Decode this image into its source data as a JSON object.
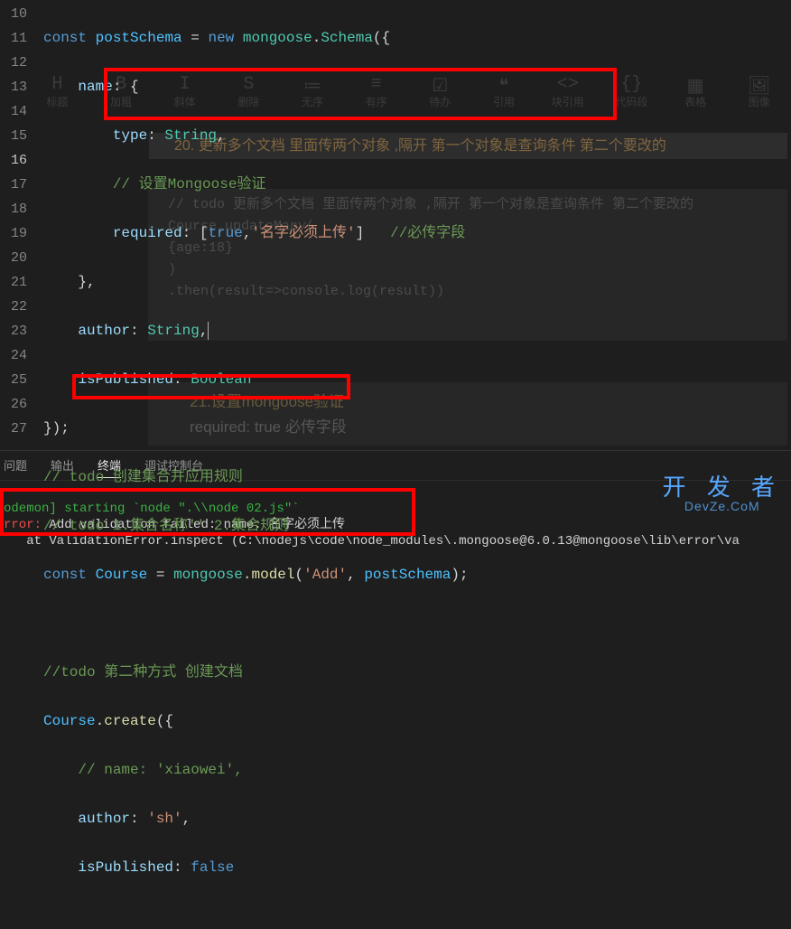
{
  "gutter": [
    "10",
    "11",
    "12",
    "13",
    "14",
    "15",
    "16",
    "17",
    "18",
    "19",
    "20",
    "21",
    "22",
    "23",
    "24",
    "25",
    "26",
    "27"
  ],
  "current_line": "16",
  "code": {
    "l10": {
      "kw": "const",
      "var": "postSchema",
      "op": "=",
      "kw2": "new",
      "cls": "mongoose",
      "punct1": ".",
      "cls2": "Schema",
      "punct2": "({"
    },
    "l11": {
      "prop": "name",
      "punct": ": {"
    },
    "l12": {
      "prop": "type",
      "punct": ": ",
      "cls": "String",
      "comma": ","
    },
    "l13": {
      "cmt": "// 设置Mongoose验证"
    },
    "l14": {
      "prop": "required",
      "punct": ": [",
      "bool": "true",
      "comma": ",",
      "str": "'名字必须上传'",
      "punct2": "]",
      "cmt": "//必传字段"
    },
    "l15": {
      "punct": "},"
    },
    "l16": {
      "prop": "author",
      "punct": ": ",
      "cls": "String",
      "comma": ","
    },
    "l17": {
      "prop": "isPublished",
      "punct": ": ",
      "cls": "Boolean"
    },
    "l18": {
      "punct": "});"
    },
    "l19": {
      "cmt": "// todo 创建集合并应用规则"
    },
    "l20": {
      "cmt": "// todo 1.集合名称'' 2.集合规则"
    },
    "l21": {
      "kw": "const",
      "var": "Course",
      "op": "=",
      "cls": "mongoose",
      "punct": ".",
      "fn": "model",
      "paren": "(",
      "str1": "'Add'",
      "comma": ", ",
      "var2": "postSchema",
      "paren2": ");"
    },
    "l22": {},
    "l23": {
      "cmt": "//todo 第二种方式 创建文档"
    },
    "l24": {
      "var": "Course",
      "punct": ".",
      "fn": "create",
      "paren": "({"
    },
    "l25": {
      "cmt": "// name: 'xiaowei',"
    },
    "l26": {
      "prop": "author",
      "punct": ": ",
      "str": "'sh'",
      "comma": ","
    },
    "l27": {
      "prop": "isPublished",
      "punct": ": ",
      "bool": "false"
    }
  },
  "ghost_toolbar": [
    {
      "icon": "H",
      "lbl": "标题"
    },
    {
      "icon": "B",
      "lbl": "加粗"
    },
    {
      "icon": "I",
      "lbl": "斜体"
    },
    {
      "icon": "S",
      "lbl": "删除"
    },
    {
      "icon": "≔",
      "lbl": "无序"
    },
    {
      "icon": "≡",
      "lbl": "有序"
    },
    {
      "icon": "☑",
      "lbl": "待办"
    },
    {
      "icon": "❝",
      "lbl": "引用"
    },
    {
      "icon": "<>",
      "lbl": "块引用"
    },
    {
      "icon": "{}",
      "lbl": "代码段"
    },
    {
      "icon": "▦",
      "lbl": "表格"
    },
    {
      "icon": "🖼",
      "lbl": "图像"
    }
  ],
  "ghost_band1": "20.  更新多个文档 里面传两个对象 ,隔开 第一个对象是查询条件 第二个要改的",
  "ghost_band3_l1": "21.设置mongoose验证",
  "ghost_band3_l2": "required: true   必传字段",
  "terminal_tabs": {
    "problems": "问题",
    "output": "输出",
    "terminal": "终端",
    "debug": "调试控制台"
  },
  "terminal": {
    "l1": "odemon] starting `node \".\\\\node 02.js\"`",
    "l2a": "rror:",
    "l2b": " Add validation failed: name: 名字必须上传",
    "l3": "   at ValidationError.inspect (C:\\nodejs\\code\\node_modules\\.mongoose@6.0.13@mongoose\\lib\\error\\va"
  },
  "watermark": {
    "big": "开 发 者",
    "small": "DevZe.CoM"
  },
  "statusbar_left": "问题 输出",
  "statusbar_right": "modules\\ mongoose@6.0.13@mongoose\\lib\\error\\va"
}
